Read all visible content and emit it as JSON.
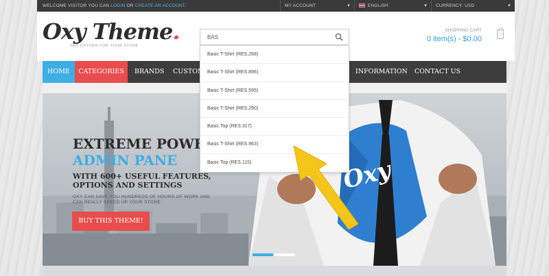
{
  "topbar": {
    "welcome_prefix": "WELCOME VISITOR YOU CAN",
    "login": "LOGIN",
    "or": "OR",
    "create_account": "CREATE AN ACCOUNT.",
    "my_account": "MY ACCOUNT",
    "language": "ENGLISH",
    "currency": "CURRENCY: USD"
  },
  "header": {
    "logo_text": "Oxy Theme",
    "logo_dot": ".",
    "tagline": "GET OXYGEN FOR YOUR STORE",
    "cart_label": "SHOPPING CART",
    "cart_value": "0 item(s) - $0.00"
  },
  "search": {
    "value": "BAS",
    "suggestions": [
      "Basic T-Shirt (RES.268)",
      "Basic T-Shirt (RES.896)",
      "Basic T-Shirt (RES.595)",
      "Basic T-Shirt (RES.290)",
      "Basic Top (RES.317)",
      "Basic T-Shirt (RES.963)",
      "Basic Top (RES.115)"
    ]
  },
  "nav": {
    "home": "HOME",
    "categories": "CATEGORIES",
    "brands": "BRANDS",
    "custom": "CUSTOM",
    "information": "INFORMATION",
    "contact": "CONTACT US"
  },
  "hero": {
    "title1": "EXTREME POWE",
    "title2": "ADMIN PANE",
    "sub": "WITH 600+ USEFUL FEATURES, OPTIONS AND SETTINGS",
    "small": "OXY CAN SAVE YOU HUNDREDS OF HOURS OF WORK AND CAN REALLY SPEED UP YOUR STORE",
    "button": "BUY THIS THEME!",
    "shirt_logo": "Oxy"
  },
  "colors": {
    "accent_blue": "#3eaee5",
    "accent_red": "#e84c4c",
    "nav_bg": "#3d3d3d",
    "arrow": "#f5c518"
  }
}
